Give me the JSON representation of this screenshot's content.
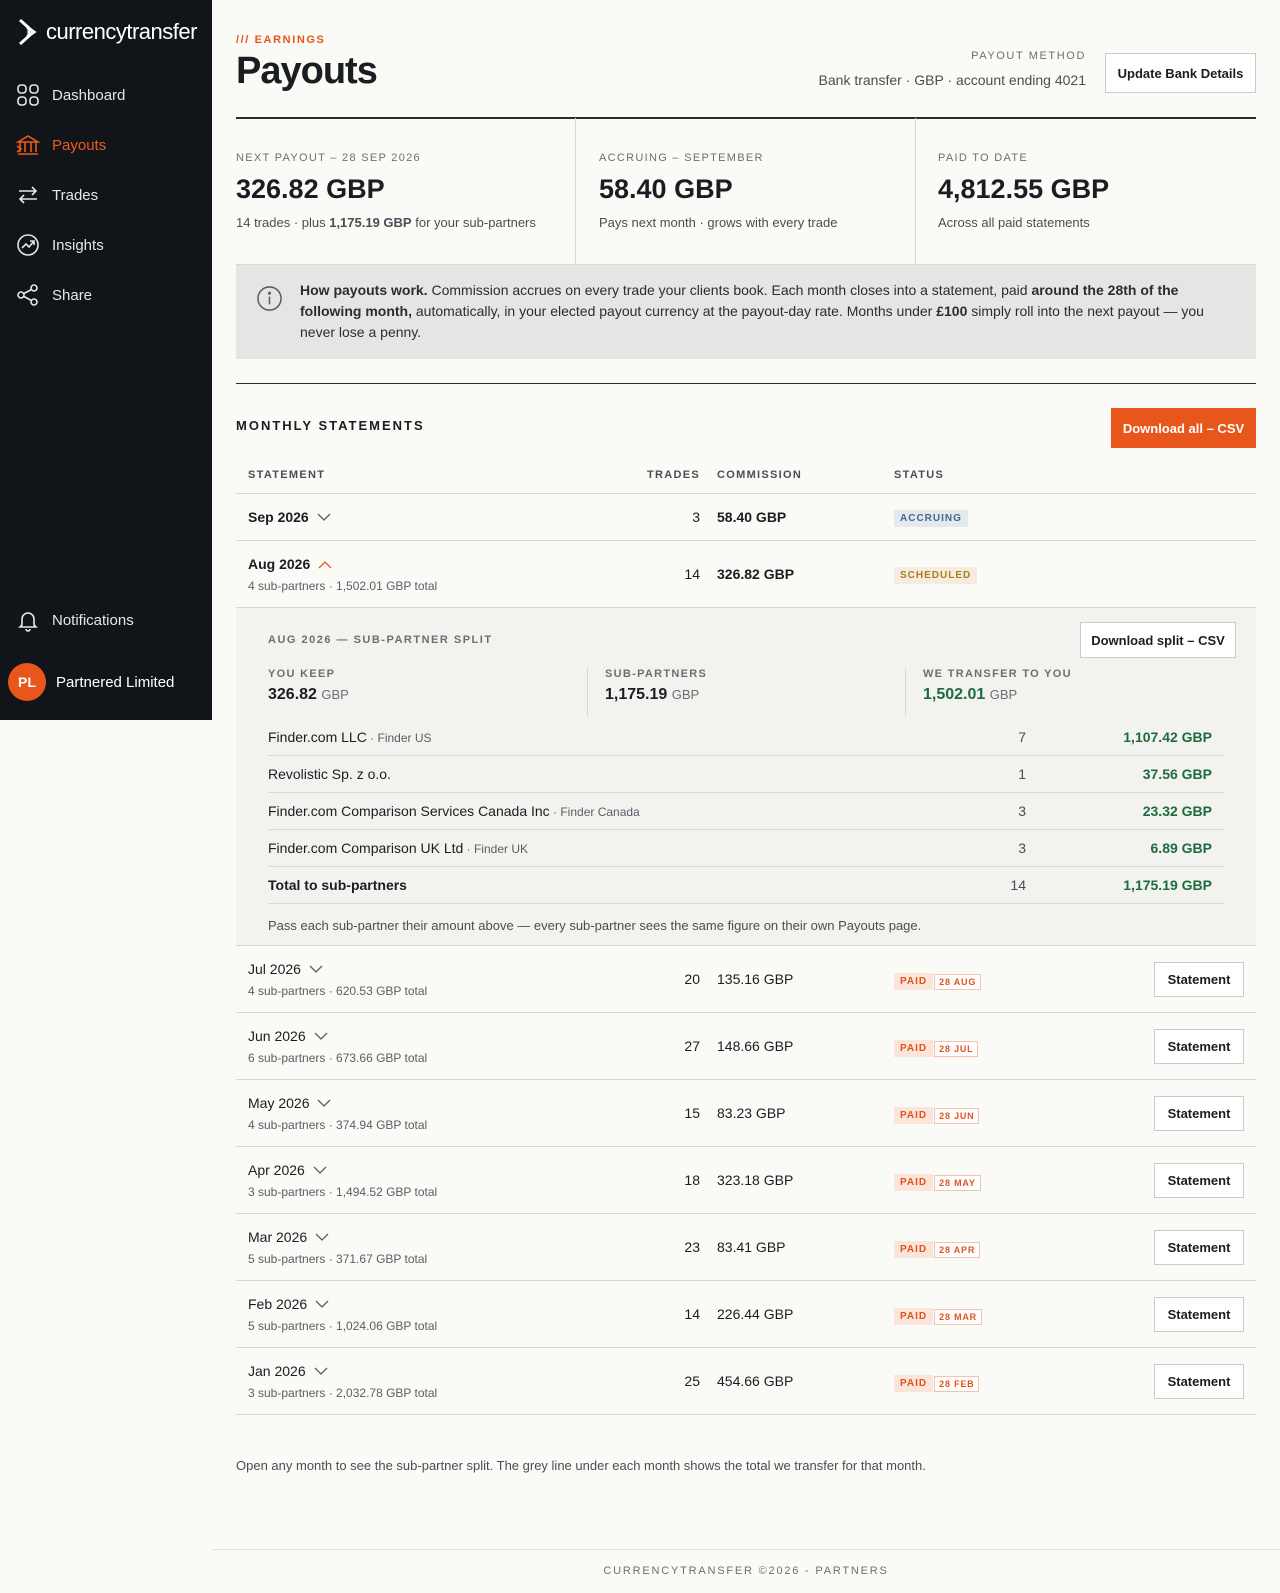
{
  "brand": {
    "name": "currencytransfer"
  },
  "nav": {
    "dashboard": "Dashboard",
    "payouts": "Payouts",
    "trades": "Trades",
    "insights": "Insights",
    "share": "Share",
    "notifications": "Notifications"
  },
  "account": {
    "initials": "PL",
    "name": "Partnered Limited"
  },
  "header": {
    "eyebrow": "/// EARNINGS",
    "title": "Payouts",
    "payout_method_label": "PAYOUT METHOD",
    "payout_method_value": "Bank transfer · GBP · account ending 4021",
    "update_button": "Update Bank Details"
  },
  "stats": {
    "next": {
      "label": "NEXT PAYOUT – 28 SEP 2026",
      "value": "326.82 GBP",
      "sub_a": "14 trades · plus ",
      "sub_b": "1,175.19 GBP",
      "sub_c": " for your sub-partners"
    },
    "accruing": {
      "label": "ACCRUING – SEPTEMBER",
      "value": "58.40 GBP",
      "sub": "Pays next month · grows with every trade"
    },
    "paid": {
      "label": "PAID TO DATE",
      "value": "4,812.55 GBP",
      "sub": "Across all paid statements"
    }
  },
  "info": {
    "t1": "How payouts work.",
    "t2": " Commission accrues on every trade your clients book. Each month closes into a statement, paid ",
    "t3": "around the 28th of the following month,",
    "t4": " automatically, in your elected payout currency at the payout-day rate. Months under ",
    "t5": "£100",
    "t6": " simply roll into the next payout — you never lose a penny."
  },
  "statements": {
    "title": "MONTHLY STATEMENTS",
    "download_all": "Download all – CSV",
    "headers": {
      "statement": "STATEMENT",
      "trades": "TRADES",
      "commission": "COMMISSION",
      "status": "STATUS"
    },
    "sep": {
      "month": "Sep 2026",
      "trades": "3",
      "commission": "58.40 GBP",
      "status": "ACCRUING"
    },
    "aug": {
      "month": "Aug 2026",
      "sub": "4 sub-partners · 1,502.01 GBP total",
      "trades": "14",
      "commission": "326.82 GBP",
      "status": "SCHEDULED"
    },
    "split": {
      "title": "AUG 2026 — SUB-PARTNER SPLIT",
      "download": "Download split – CSV",
      "keep_label": "YOU KEEP",
      "keep_value": "326.82",
      "keep_unit": "GBP",
      "subs_label": "SUB-PARTNERS",
      "subs_value": "1,175.19",
      "subs_unit": "GBP",
      "transfer_label": "WE TRANSFER TO YOU",
      "transfer_value": "1,502.01",
      "transfer_unit": "GBP",
      "rows": [
        {
          "name": "Finder.com LLC",
          "tag": " · Finder US",
          "count": "7",
          "amount": "1,107.42 GBP"
        },
        {
          "name": "Revolistic Sp. z o.o.",
          "tag": "",
          "count": "1",
          "amount": "37.56 GBP"
        },
        {
          "name": "Finder.com Comparison Services Canada Inc",
          "tag": " · Finder Canada",
          "count": "3",
          "amount": "23.32 GBP"
        },
        {
          "name": "Finder.com Comparison UK Ltd",
          "tag": " · Finder UK",
          "count": "3",
          "amount": "6.89 GBP"
        }
      ],
      "total": {
        "name": "Total to sub-partners",
        "count": "14",
        "amount": "1,175.19 GBP"
      },
      "note": "Pass each sub-partner their amount above — every sub-partner sees the same figure on their own Payouts page."
    },
    "paid_rows": [
      {
        "month": "Jul 2026",
        "sub": "4 sub-partners · 620.53 GBP total",
        "trades": "20",
        "commission": "135.16 GBP",
        "status": "PAID",
        "date": "28 AUG",
        "button": "Statement"
      },
      {
        "month": "Jun 2026",
        "sub": "6 sub-partners · 673.66 GBP total",
        "trades": "27",
        "commission": "148.66 GBP",
        "status": "PAID",
        "date": "28 JUL",
        "button": "Statement"
      },
      {
        "month": "May 2026",
        "sub": "4 sub-partners · 374.94 GBP total",
        "trades": "15",
        "commission": "83.23 GBP",
        "status": "PAID",
        "date": "28 JUN",
        "button": "Statement"
      },
      {
        "month": "Apr 2026",
        "sub": "3 sub-partners · 1,494.52 GBP total",
        "trades": "18",
        "commission": "323.18 GBP",
        "status": "PAID",
        "date": "28 MAY",
        "button": "Statement"
      },
      {
        "month": "Mar 2026",
        "sub": "5 sub-partners · 371.67 GBP total",
        "trades": "23",
        "commission": "83.41 GBP",
        "status": "PAID",
        "date": "28 APR",
        "button": "Statement"
      },
      {
        "month": "Feb 2026",
        "sub": "5 sub-partners · 1,024.06 GBP total",
        "trades": "14",
        "commission": "226.44 GBP",
        "status": "PAID",
        "date": "28 MAR",
        "button": "Statement"
      },
      {
        "month": "Jan 2026",
        "sub": "3 sub-partners · 2,032.78 GBP total",
        "trades": "25",
        "commission": "454.66 GBP",
        "status": "PAID",
        "date": "28 FEB",
        "button": "Statement"
      }
    ],
    "footnote": "Open any month to see the sub-partner split. The grey line under each month shows the total we transfer for that month."
  },
  "footer": {
    "text": "CURRENCYTRANSFER ©2026 - PARTNERS"
  },
  "colors": {
    "accent": "#e9561b",
    "sidebar": "#111418",
    "positive": "#1e6b3e"
  }
}
